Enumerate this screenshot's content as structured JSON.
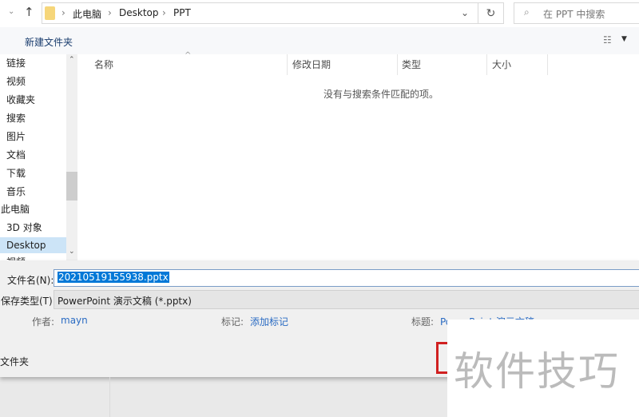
{
  "address": {
    "crumbs": [
      "此电脑",
      "Desktop",
      "PPT"
    ]
  },
  "search": {
    "placeholder": "在 PPT 中搜索"
  },
  "toolbar": {
    "new_folder": "新建文件夹"
  },
  "sidebar": {
    "items": [
      "链接",
      "视频",
      "收藏夹",
      "搜索",
      "图片",
      "文档",
      "下载",
      "音乐",
      "此电脑",
      "3D 对象",
      "Desktop",
      "视频"
    ]
  },
  "columns": [
    "名称",
    "修改日期",
    "类型",
    "大小"
  ],
  "empty_message": "没有与搜索条件匹配的项。",
  "form": {
    "filename_label": "文件名(N):",
    "filename_value": "20210519155938.pptx",
    "filetype_label": "保存类型(T):",
    "filetype_value": "PowerPoint 演示文稿 (*.pptx)"
  },
  "meta": {
    "author_label": "作者:",
    "author_value": "mayn",
    "tags_label": "标记:",
    "tags_value": "添加标记",
    "title_label": "标题:",
    "title_value": "PowerPoint 演示文稿"
  },
  "hide_folders": "文件夹",
  "watermark": "软件技巧",
  "colors": {
    "accent": "#2a6bc3",
    "selection": "#0078d7",
    "highlight": "#d02020"
  }
}
